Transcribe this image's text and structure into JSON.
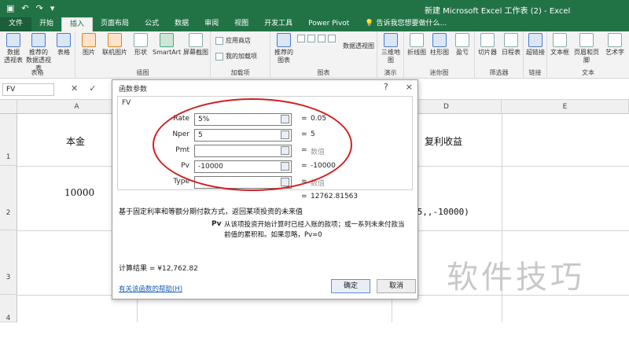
{
  "window": {
    "title": "新建 Microsoft Excel 工作表 (2) - Excel"
  },
  "ribbon_tabs": [
    {
      "label": "文件"
    },
    {
      "label": "开始"
    },
    {
      "label": "插入"
    },
    {
      "label": "页面布局"
    },
    {
      "label": "公式"
    },
    {
      "label": "数据"
    },
    {
      "label": "审阅"
    },
    {
      "label": "视图"
    },
    {
      "label": "开发工具"
    },
    {
      "label": "Power Pivot"
    }
  ],
  "tell_me": "告诉我您想要做什么...",
  "ribbon": {
    "pivot": "数据\n透视表",
    "rec_pivot": "推荐的\n数据透视表",
    "table": "表格",
    "picture": "图片",
    "online_pic": "联机图片",
    "shapes": "形状",
    "smartart": "SmartArt",
    "screenshot": "屏幕截图",
    "store": "应用商店",
    "my_addins": "我的加载项",
    "rec_charts": "推荐的\n图表",
    "pivot_chart": "数据透视图",
    "map3d": "三维地\n图",
    "line": "折线图",
    "column": "柱形图",
    "winloss": "盈亏",
    "slicer": "切片器",
    "timeline": "日程表",
    "hyperlink": "超链接",
    "textbox": "文本框",
    "header": "页眉和页脚",
    "wordart": "艺术字",
    "groups": {
      "tables": "表格",
      "illustrations": "插图",
      "addins": "加载项",
      "charts": "图表",
      "tours": "演示",
      "sparklines": "迷你图",
      "filters": "筛选器",
      "links": "链接",
      "text": "文本"
    }
  },
  "formula_bar": {
    "name_box": "FV",
    "cancel_icon": "✕",
    "enter_icon": "✓"
  },
  "sheet": {
    "columns": [
      "A",
      "D",
      "E"
    ],
    "rows": [
      "1",
      "2",
      "3",
      "4"
    ],
    "a1": "本金",
    "a2": "10000",
    "d1": "复利收益",
    "d2_partial": ".5,,-10000)"
  },
  "dialog": {
    "title": "函数参数",
    "close": "×",
    "help_q": "?",
    "function_name": "FV",
    "args": [
      {
        "label": "Rate",
        "value": "5%",
        "result": "0.05",
        "result_gray": false
      },
      {
        "label": "Nper",
        "value": "5",
        "result": "5",
        "result_gray": false
      },
      {
        "label": "Pmt",
        "value": "",
        "result": "数值",
        "result_gray": true
      },
      {
        "label": "Pv",
        "value": "-10000",
        "result": "-10000",
        "result_gray": false
      },
      {
        "label": "Type",
        "value": "",
        "result": "数值",
        "result_gray": true
      }
    ],
    "total_eq": "=",
    "total": "12762.81563",
    "description": "基于固定利率和等额分期付款方式，返回某项投资的未来值",
    "pv_label": "Pv",
    "pv_desc": "从该项投资开始计算时已经入账的款项；或一系列未来付款当前值的累积和。如果忽略，Pv=0",
    "calc_result": "计算结果 =  ¥12,762.82",
    "help_link": "有关该函数的帮助(H)",
    "ok": "确定",
    "cancel": "取消"
  },
  "watermark": "软件技巧",
  "colors": {
    "excel_green": "#217346",
    "highlight_red": "#d21f1f"
  }
}
